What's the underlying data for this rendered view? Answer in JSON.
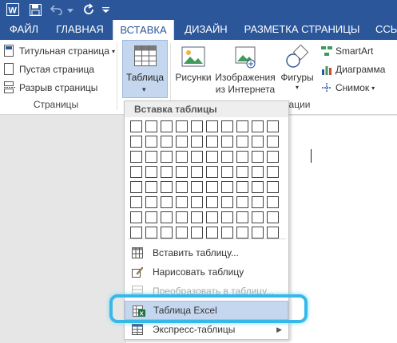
{
  "tabs": {
    "file": "ФАЙЛ",
    "home": "ГЛАВНАЯ",
    "insert": "ВСТАВКА",
    "design": "ДИЗАЙН",
    "layout": "РАЗМЕТКА СТРАНИЦЫ",
    "references": "ССЫ"
  },
  "pages_group": {
    "cover": "Титульная страница",
    "blank": "Пустая страница",
    "break": "Разрыв страницы",
    "label": "Страницы"
  },
  "tables_group": {
    "button": "Таблица"
  },
  "illustrations_group": {
    "pictures": "Рисунки",
    "online_line1": "Изображения",
    "online_line2": "из Интернета",
    "shapes": "Фигуры",
    "smartart": "SmartArt",
    "chart": "Диаграмма",
    "screenshot": "Снимок",
    "label_partial": "ации"
  },
  "menu": {
    "header": "Вставка таблицы",
    "grid_cols": 10,
    "grid_rows": 8,
    "items": [
      {
        "label": "Вставить таблицу...",
        "disabled": false
      },
      {
        "label": "Нарисовать таблицу",
        "disabled": false
      },
      {
        "label": "Преобразовать в таблицу...",
        "disabled": true
      },
      {
        "label": "Таблица Excel",
        "disabled": false,
        "highlighted": true
      },
      {
        "label": "Экспресс-таблицы",
        "disabled": false,
        "submenu": true
      }
    ]
  },
  "colors": {
    "ribbon_blue": "#2b579a",
    "highlight": "#c5d7ee",
    "focus_ring": "#36b9e8"
  }
}
